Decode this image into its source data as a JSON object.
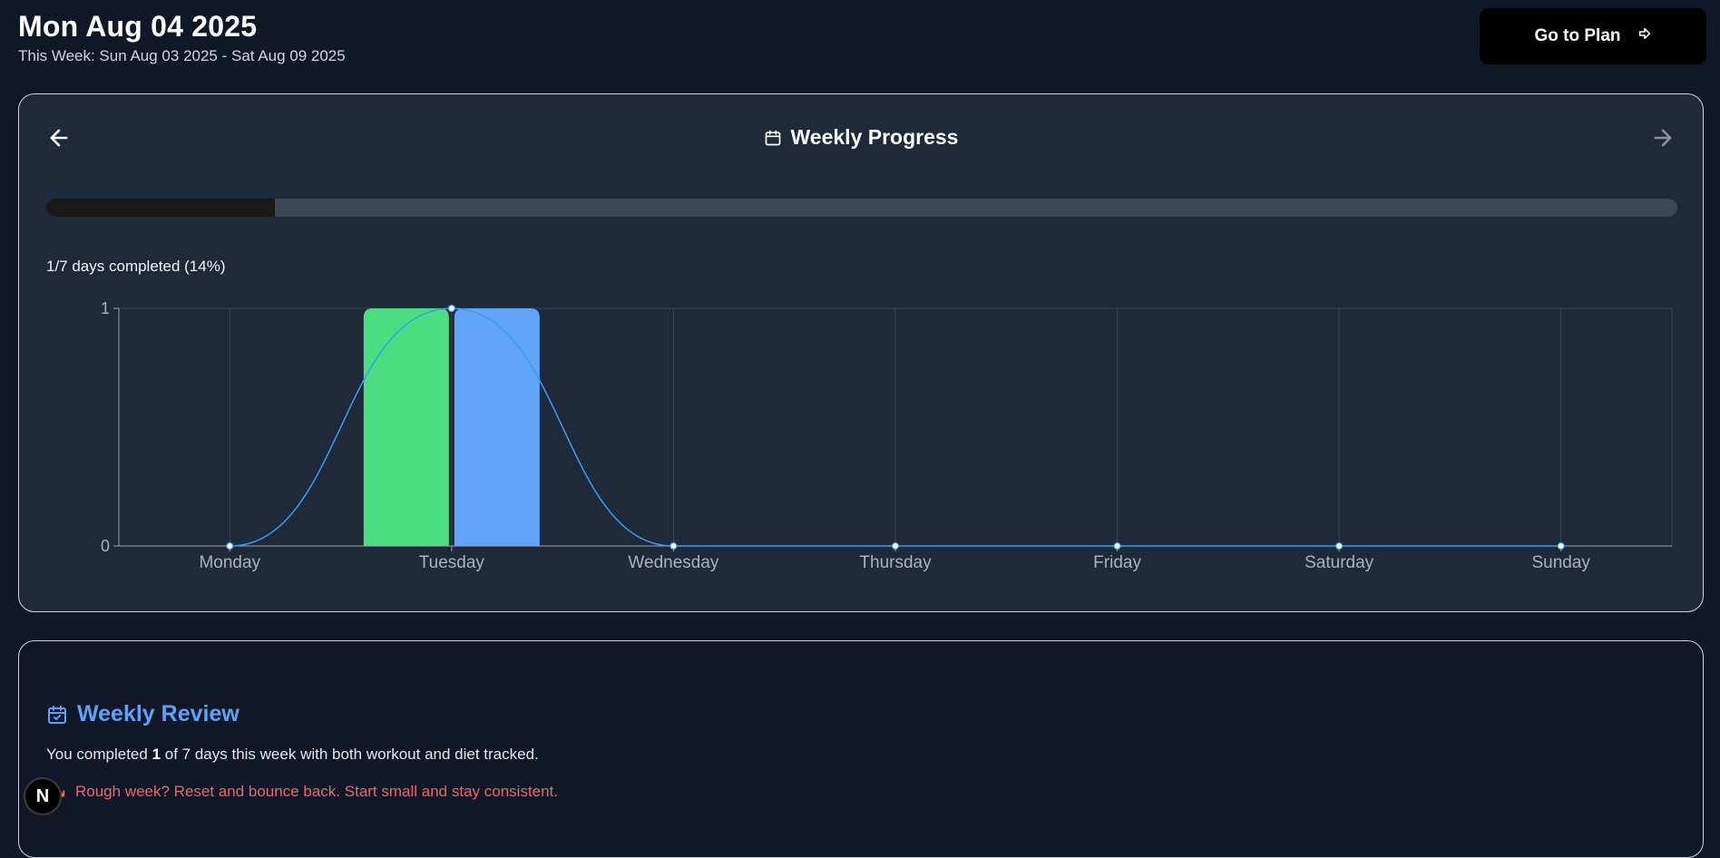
{
  "header": {
    "date_title": "Mon Aug 04 2025",
    "week_range": "This Week: Sun Aug 03 2025 - Sat Aug 09 2025"
  },
  "plan_button": {
    "label": "Go to Plan",
    "icon": "arrow-right-icon"
  },
  "progress_card": {
    "title": "Weekly Progress",
    "title_icon": "calendar-icon",
    "prev_icon": "arrow-left-icon",
    "next_icon": "arrow-right-icon",
    "progress_fraction": 0.14,
    "progress_text": "1/7 days completed (14%)"
  },
  "chart_data": {
    "type": "bar",
    "categories": [
      "Monday",
      "Tuesday",
      "Wednesday",
      "Thursday",
      "Friday",
      "Saturday",
      "Sunday"
    ],
    "series": [
      {
        "values": [
          0,
          1,
          0,
          0,
          0,
          0,
          0
        ],
        "color": "#4ade80",
        "kind": "bar"
      },
      {
        "values": [
          0,
          1,
          0,
          0,
          0,
          0,
          0
        ],
        "color": "#60a5fa",
        "kind": "bar"
      },
      {
        "values": [
          0,
          1,
          0,
          0,
          0,
          0,
          0
        ],
        "color": "#3b9df0",
        "kind": "line"
      }
    ],
    "yticks": [
      "0",
      "1"
    ],
    "ylim": [
      0,
      1
    ],
    "grid": true
  },
  "review_card": {
    "title": "Weekly Review",
    "title_icon": "calendar-check-icon",
    "summary_before": "You completed ",
    "summary_count": "1",
    "summary_after": " of 7 days this week with both workout and diet tracked.",
    "warning_icon": "trending-down-icon",
    "warning": "Rough week? Reset and bounce back. Start small and stay consistent."
  },
  "dev_badge": {
    "label": "N"
  },
  "colors": {
    "background": "#101828",
    "card": "#1e2939",
    "accent": "#5ea2f8",
    "warning": "#f06565"
  }
}
